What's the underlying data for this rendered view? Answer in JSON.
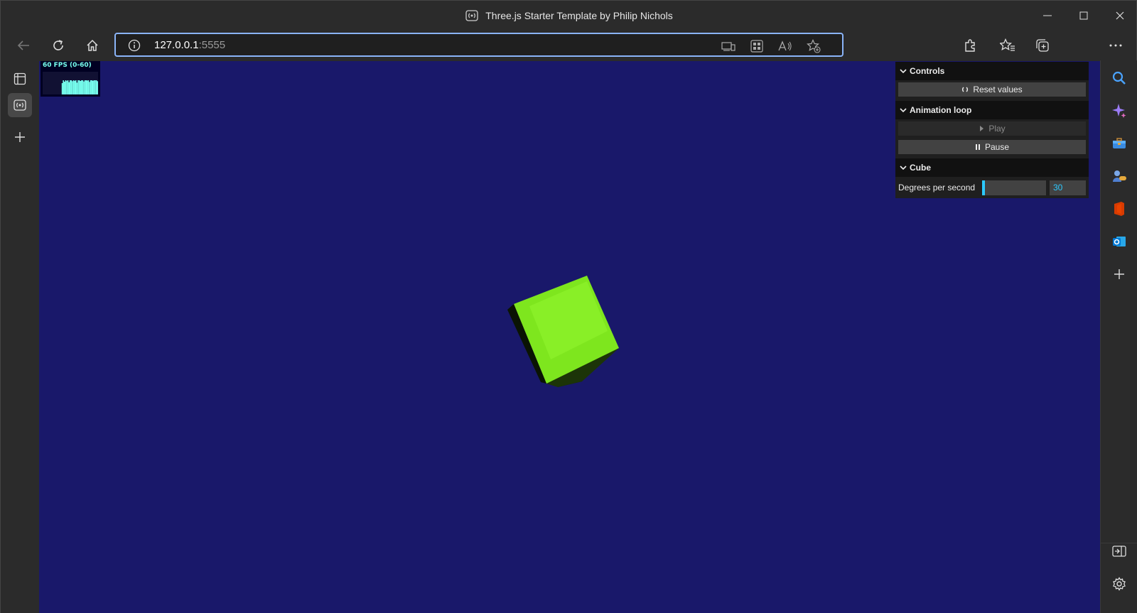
{
  "window": {
    "title": "Three.js Starter Template by Philip Nichols",
    "tab_icon": "broadcast-icon",
    "controls": [
      "minimize-icon",
      "maximize-icon",
      "close-icon"
    ]
  },
  "toolbar": {
    "url_host": "127.0.0.1",
    "url_port": ":5555",
    "buttons": [
      "back-icon",
      "refresh-icon",
      "home-icon"
    ],
    "address_icons": [
      "devices-icon",
      "app-grid-icon",
      "read-aloud-icon",
      "add-favorite-icon"
    ],
    "right_icons": [
      "extensions-icon",
      "favorites-icon",
      "collections-icon",
      "more-icon"
    ]
  },
  "stats": {
    "label": "60 FPS (0-60)",
    "fps_history": [
      48,
      60,
      54,
      60,
      58,
      60,
      52,
      60,
      60,
      56,
      60,
      58,
      60,
      50,
      60,
      60,
      57,
      60,
      60,
      55,
      60,
      60,
      59,
      60,
      53,
      60,
      60,
      58,
      60,
      60,
      60,
      56
    ]
  },
  "gui": {
    "controls_title": "Controls",
    "reset_label": "Reset values",
    "animation_title": "Animation loop",
    "play_label": "Play",
    "pause_label": "Pause",
    "cube_title": "Cube",
    "degrees_label": "Degrees per second",
    "degrees_value": "30",
    "degrees_fraction": 0.04
  },
  "scene": {
    "background": "#19186a",
    "cube_color": "#7ee61e"
  }
}
